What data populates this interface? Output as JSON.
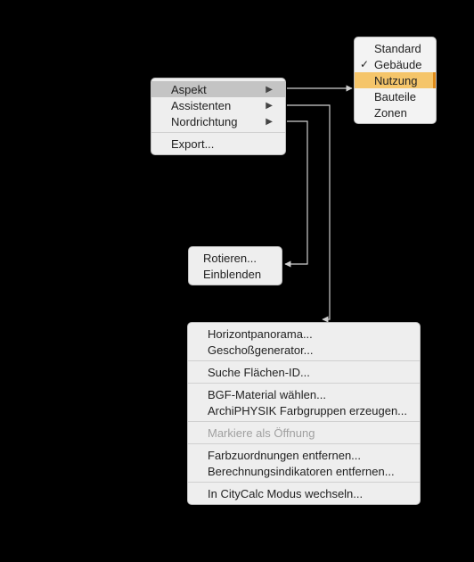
{
  "main_menu": {
    "items": [
      {
        "label": "Aspekt",
        "has_submenu": true,
        "highlighted": true
      },
      {
        "label": "Assistenten",
        "has_submenu": true
      },
      {
        "label": "Nordrichtung",
        "has_submenu": true
      },
      {
        "label": "Export..."
      }
    ]
  },
  "aspekt_submenu": {
    "items": [
      {
        "label": "Standard"
      },
      {
        "label": "Gebäude",
        "checked": true
      },
      {
        "label": "Nutzung",
        "selected": true
      },
      {
        "label": "Bauteile"
      },
      {
        "label": "Zonen"
      }
    ]
  },
  "nord_submenu": {
    "items": [
      {
        "label": "Rotieren..."
      },
      {
        "label": "Einblenden"
      }
    ]
  },
  "assist_submenu": {
    "groups": [
      [
        {
          "label": "Horizontpanorama..."
        },
        {
          "label": "Geschoßgenerator..."
        }
      ],
      [
        {
          "label": "Suche Flächen-ID..."
        }
      ],
      [
        {
          "label": "BGF-Material wählen..."
        },
        {
          "label": "ArchiPHYSIK Farbgruppen erzeugen..."
        }
      ],
      [
        {
          "label": "Markiere als Öffnung",
          "disabled": true
        }
      ],
      [
        {
          "label": "Farbzuordnungen entfernen..."
        },
        {
          "label": "Berechnungsindikatoren entfernen..."
        }
      ],
      [
        {
          "label": "In CityCalc Modus wechseln..."
        }
      ]
    ]
  }
}
